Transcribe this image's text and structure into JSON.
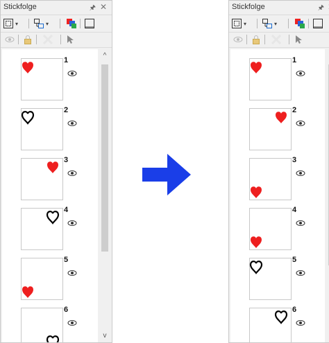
{
  "panel_title": "Stickfolge",
  "left": {
    "items": [
      {
        "number": "1",
        "heart": "filled-red",
        "pos": "top-left"
      },
      {
        "number": "2",
        "heart": "outline-black",
        "pos": "top-left"
      },
      {
        "number": "3",
        "heart": "filled-red",
        "pos": "top-right"
      },
      {
        "number": "4",
        "heart": "outline-black",
        "pos": "top-right"
      },
      {
        "number": "5",
        "heart": "filled-red",
        "pos": "bottom-left"
      },
      {
        "number": "6",
        "heart": "outline-black",
        "pos": "bottom-right"
      }
    ]
  },
  "right": {
    "items": [
      {
        "number": "1",
        "heart": "filled-red",
        "pos": "top-left"
      },
      {
        "number": "2",
        "heart": "filled-red",
        "pos": "top-right"
      },
      {
        "number": "3",
        "heart": "filled-red",
        "pos": "bottom-left"
      },
      {
        "number": "4",
        "heart": "filled-red",
        "pos": "bottom-left"
      },
      {
        "number": "5",
        "heart": "outline-black",
        "pos": "top-left"
      },
      {
        "number": "6",
        "heart": "outline-black",
        "pos": "top-right"
      }
    ]
  },
  "colors": {
    "heart_fill": "#ee1f1f",
    "heart_outline": "#000000",
    "arrow": "#1a3ee8"
  },
  "icons": [
    "pin-icon",
    "close-icon",
    "select-all-icon",
    "group-icon",
    "color-sort-icon",
    "window-icon",
    "eye-icon",
    "lock-icon",
    "delete-icon",
    "cursor-icon"
  ]
}
